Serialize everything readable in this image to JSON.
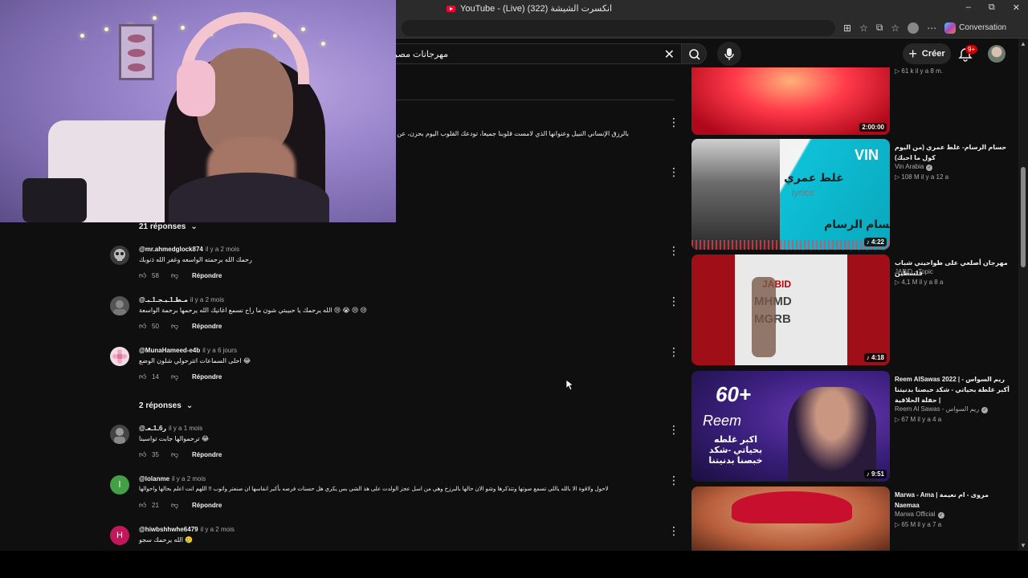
{
  "browser": {
    "tab_title": "YouTube - (Live) انكسرت الشيشة (322)",
    "win_min": "–",
    "win_max": "⧉",
    "win_close": "✕",
    "toolbar_icons": [
      "⊞",
      "☆",
      "⧉",
      "☆",
      "⋯"
    ],
    "conversation_label": "Conversation"
  },
  "header": {
    "search_value": "مهرجانات مصرية",
    "create_label": "Créer",
    "notification_badge": "9+"
  },
  "top_comment": {
    "text": "بالرزق الإنساني النبيل وعنوانها الذي لامست قلوبنا جميعاً، تودعك القلوب اليوم بحزن، عن"
  },
  "replies_toggle_1": "21 réponses",
  "replies_toggle_2": "2 réponses",
  "comments": [
    {
      "author": "@mr.ahmedglock874",
      "time": "il y a 2 mois",
      "text": "رحمك الله برحمته الواسعه وغفر الله ذنوبك",
      "likes": "58",
      "reply_label": "Répondre",
      "avatar_letter": "",
      "avatar_color": "#3a3a3a"
    },
    {
      "author": "@مـطـ1ـيـجـ1ـبـ",
      "time": "il y a 2 mois",
      "text": "الله يرحمك يا حبيبتي شون ما راح نسمع اغانيك الله يرحمها برحمة الواسعة 😢 😭 😢 😢",
      "likes": "50",
      "reply_label": "Répondre",
      "avatar_letter": "",
      "avatar_color": "#555555"
    },
    {
      "author": "@MunaHameed-e4b",
      "time": "il y a 6 jours",
      "text": "احلى السماعات اتترحولي شلون الوضع 😂",
      "likes": "14",
      "reply_label": "Répondre",
      "avatar_letter": "",
      "avatar_color": "#f1dde6"
    },
    {
      "author": "@ر6ـ1ـعـ",
      "time": "il y a 1 mois",
      "text": "ترحموالها جابت تواسينا 😂",
      "likes": "35",
      "reply_label": "Répondre",
      "avatar_letter": "",
      "avatar_color": "#444444"
    },
    {
      "author": "@lolanme",
      "time": "il y a 2 mois",
      "text": "لاحول ولاقوة الا بالله ياللي تسمع صوتها وتتذكرها وشو الان حالها بالبرزخ وهي من اسل عجز الولدت على هذ الشي بس يكري هل حسنات فرصه بأكبر انفاسها ان صنعتر واتوب !! اللهم انت اعلم بحالها واحوالها",
      "likes": "21",
      "reply_label": "Répondre",
      "avatar_letter": "l",
      "avatar_color": "#43a047"
    },
    {
      "author": "@hiwbshhwhe6479",
      "time": "il y a 2 mois",
      "text": "الله يرحمك سجو 🥲",
      "likes": "",
      "reply_label": "",
      "avatar_letter": "H",
      "avatar_color": "#c2185b"
    }
  ],
  "recommendations": [
    {
      "title": "",
      "channel": "",
      "meta": "61 k   il y a 8 m.",
      "duration": "2:00:00",
      "verified": false
    },
    {
      "title": "حسام الرسام- غلط عمري (من اليوم كول ما احبك)",
      "channel": "Vin Arabia",
      "meta": "108 M   il y a 12 a",
      "duration": "4:22",
      "verified": true,
      "thumb_text_1": "غلط عمري",
      "thumb_text_2": "lyrics",
      "thumb_text_3": "حسام الرسام",
      "thumb_logo": "VIN"
    },
    {
      "title": "مهرجان أصلعي على طواحيني شباب فلسطين",
      "channel": "JABiD - Topic",
      "meta": "4,1 M   il y a 8 a",
      "duration": "4:18",
      "verified": false,
      "thumb_text_1": "JABID",
      "thumb_text_2": "MHMD",
      "thumb_text_3": "MGRB"
    },
    {
      "title": "Reem AlSawas 2022 | ريم السواس - أكبر غلطة بحياتي - شكد خبصنا بدنيتنا | حفلة الحلاقية",
      "channel": "Reem Al Sawas - ريم السواس",
      "meta": "67 M   il y a 4 a",
      "duration": "9:51",
      "verified": true,
      "thumb_text_1": "60+",
      "thumb_text_2": "Reem",
      "thumb_text_3": "اكبر غلطه بحياتي -شكد خبصنا بدنيتنا"
    },
    {
      "title": "Marwa - Ama | مروى - ام نعيمة Naemaa",
      "channel": "Marwa Official",
      "meta": "65 M   il y a 7 a",
      "duration": "",
      "verified": true
    }
  ],
  "colors": {
    "background": "#0f0f0f",
    "accent_red": "#ff0033",
    "text_primary": "#f1f1f1",
    "text_secondary": "#aaaaaa"
  }
}
